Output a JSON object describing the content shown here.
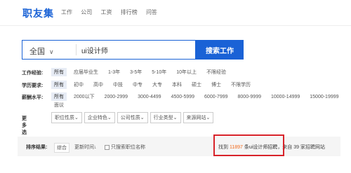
{
  "header": {
    "logo": "职友集",
    "nav": [
      "工作",
      "公司",
      "工资",
      "排行榜",
      "问答"
    ]
  },
  "search": {
    "region": "全国",
    "value": "ui设计师",
    "button": "搜索工作"
  },
  "filters": [
    {
      "label": "工作经验:",
      "options": [
        "所有",
        "应届毕业生",
        "1-3年",
        "3-5年",
        "5-10年",
        "10年以上",
        "不限经验"
      ]
    },
    {
      "label": "学历要求:",
      "options": [
        "所有",
        "初中",
        "高中",
        "中技",
        "中专",
        "大专",
        "本科",
        "硕士",
        "博士",
        "不限学历"
      ]
    },
    {
      "label": "薪酬水平:",
      "options": [
        "所有",
        "2000以下",
        "2000-2999",
        "3000-4499",
        "4500-5999",
        "6000-7999",
        "8000-9999",
        "10000-14999",
        "15000-19999"
      ],
      "wrap": "面议"
    }
  ],
  "more": {
    "label": "更多选项:",
    "dropdowns": [
      "职位性质",
      "企业特色",
      "公司性质",
      "行业类型",
      "来源网站"
    ]
  },
  "results": {
    "sort_label": "排序结果:",
    "sort_options": [
      "综合",
      "更新时间"
    ],
    "checkbox": "只搜索职位名称",
    "found_prefix": "找到",
    "found_count": "11897",
    "found_keyword": "条ui设计师招聘",
    "found_suffix": "，来自 39 家招聘网站"
  },
  "colors": {
    "brand": "#1a62d6",
    "highlight_box": "#d8232a",
    "count": "#f26b1d"
  }
}
